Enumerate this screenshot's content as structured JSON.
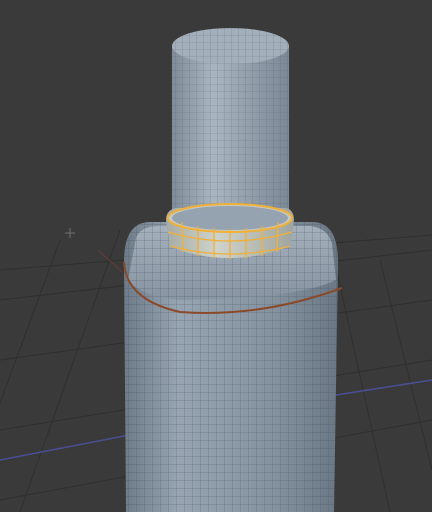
{
  "viewport": {
    "background": "#3a3a3a",
    "grid_color": "#2e2e2e",
    "axis_x_color": "#4a4f95",
    "axis_z_color": "#9a3a3a",
    "origin_marker": "crosshair-icon"
  },
  "model": {
    "bottle_body": {
      "fill": "#8a97a4",
      "mesh_color": "#3e4a57"
    },
    "neck_cylinder": {
      "fill": "#95a2af",
      "mesh_color": "#45515e"
    },
    "selected_ring": {
      "fill": "#b8bdb8",
      "highlight_color": "#f0b03a"
    },
    "shoulder_seam": {
      "color": "#8a4a2a"
    }
  }
}
